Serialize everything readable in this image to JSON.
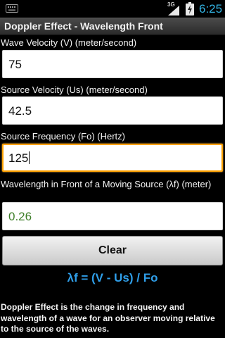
{
  "status_bar": {
    "network_type": "3G",
    "time": "6:25",
    "icons": [
      "keyboard-icon",
      "signal-icon",
      "battery-charging-icon"
    ]
  },
  "app": {
    "title": "Doppler Effect - Wavelength Front"
  },
  "form": {
    "wave_velocity": {
      "label": "Wave Velocity (V) (meter/second)",
      "value": "75"
    },
    "source_velocity": {
      "label": "Source Velocity (Us) (meter/second)",
      "value": "42.5"
    },
    "source_frequency": {
      "label": "Source Frequency (Fo) (Hertz)",
      "value": "125"
    },
    "wavelength": {
      "label": "Wavelength in Front of a Moving Source (λf) (meter)",
      "value": "0.26"
    }
  },
  "clear_button": {
    "label": "Clear"
  },
  "formula": "λf = (V - Us) / Fo",
  "description": "Doppler Effect is the change in frequency and wavelength of a wave for an observer moving relative to the source of the waves.",
  "colors": {
    "accent": "#33b5e5",
    "focus": "#ffa200",
    "formula": "#2f9ee8",
    "result_text": "#3f7f2a"
  }
}
